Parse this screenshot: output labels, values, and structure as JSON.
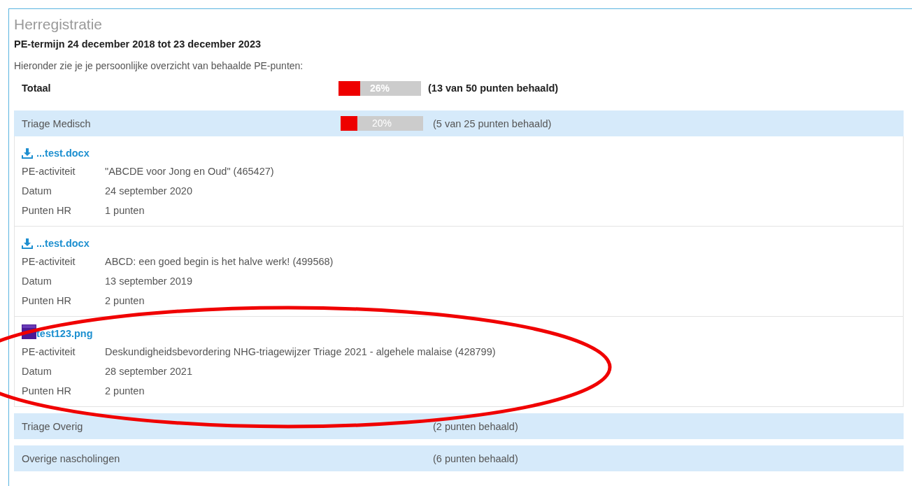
{
  "title": "Herregistratie",
  "term": "PE-termijn 24 december 2018 tot 23 december 2023",
  "intro": "Hieronder zie je je persoonlijke overzicht van behaalde PE-punten:",
  "total": {
    "label": "Totaal",
    "level": 0.26,
    "percent": "26%",
    "points": "(13 van 50 punten behaald)"
  },
  "categories": [
    {
      "name": "Triage Medisch",
      "level": 0.2,
      "percent": "20%",
      "points": "(5 van 25 punten behaald)",
      "items": [
        {
          "file": {
            "kind": "download",
            "name": "...test.docx"
          },
          "fields": [
            {
              "label": "PE-activiteit",
              "value": "\"ABCDE voor Jong en Oud\" (465427)"
            },
            {
              "label": "Datum",
              "value": "24 september 2020"
            },
            {
              "label": "Punten HR",
              "value": "1 punten"
            }
          ]
        },
        {
          "file": {
            "kind": "download",
            "name": "...test.docx"
          },
          "fields": [
            {
              "label": "PE-activiteit",
              "value": "ABCD: een goed begin is het halve werk! (499568)"
            },
            {
              "label": "Datum",
              "value": "13 september 2019"
            },
            {
              "label": "Punten HR",
              "value": "2 punten"
            }
          ]
        },
        {
          "file": {
            "name": "test123.png"
          },
          "fields": [
            {
              "label": "PE-activiteit",
              "value": "Deskundigheidsbevordering NHG-triagewijzer Triage 2021 - algehele malaise (428799)"
            },
            {
              "label": "Datum",
              "value": "28 september 2021"
            },
            {
              "label": "Punten HR",
              "value": "2 punten"
            }
          ]
        }
      ]
    },
    {
      "name": "Triage Overig",
      "points": "(2 punten behaald)"
    },
    {
      "name": "Overige nascholingen",
      "points": "(6 punten behaald)"
    }
  ],
  "annotation": {
    "kind": "ellipse"
  }
}
